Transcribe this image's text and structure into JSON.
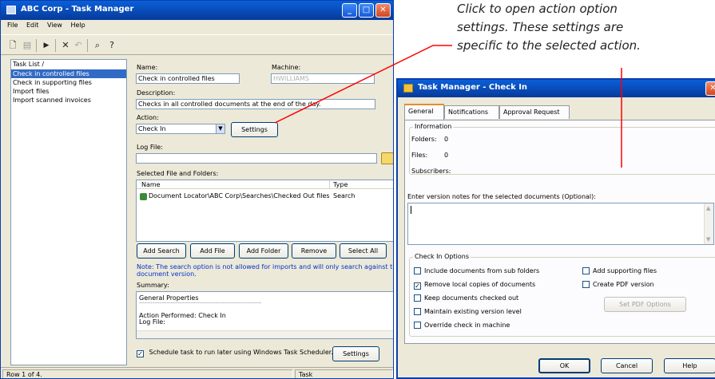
{
  "main_window": {
    "title": "ABC Corp - Task Manager",
    "menu": [
      "File",
      "Edit",
      "View",
      "Help"
    ],
    "task_list": {
      "header": "Task List /",
      "items": [
        "Check in controlled files",
        "Check in supporting files",
        "Import files",
        "Import scanned invoices"
      ],
      "selected_index": 0
    },
    "name_label": "Name:",
    "name_value": "Check in controlled files",
    "machine_label": "Machine:",
    "machine_value": "HWILLIAMS",
    "description_label": "Description:",
    "description_value": "Checks in all controlled documents at the end of the day.",
    "action_label": "Action:",
    "action_value": "Check In",
    "action_settings_button": "Settings",
    "logfile_label": "Log File:",
    "logfile_value": "",
    "selected_label": "Selected File and Folders:",
    "columns": [
      "Name",
      "Type"
    ],
    "rows": [
      {
        "name": "Document Locator\\ABC Corp\\Searches\\Checked Out files",
        "type": "Search"
      }
    ],
    "buttons": {
      "add_search": "Add Search",
      "add_file": "Add File",
      "add_folder": "Add Folder",
      "remove": "Remove",
      "select_all": "Select All"
    },
    "note": "Note: The search option is not allowed for imports and will only search against the la",
    "note_2": "document version.",
    "summary_label": "Summary:",
    "summary_lines": [
      "General Properties",
      "-------------------------------------------------------------------------------------",
      "Action Performed: Check In",
      "Log File:"
    ],
    "schedule_label": "Schedule task to run later using Windows Task Scheduler.",
    "schedule_checked": true,
    "schedule_settings_button": "Settings",
    "status": {
      "left": "Row 1 of 4.",
      "right": "Task"
    }
  },
  "dialog": {
    "title": "Task Manager - Check In",
    "tabs": [
      "General",
      "Notifications",
      "Approval Request"
    ],
    "active_tab": 0,
    "information": {
      "title": "Information",
      "folders_label": "Folders:",
      "folders_value": "0",
      "files_label": "Files:",
      "files_value": "0",
      "subscribers_label": "Subscribers:"
    },
    "version_notes_label": "Enter version notes for the selected documents (Optional):",
    "version_notes_value": "",
    "check_in_options": {
      "title": "Check In Options",
      "include_sub": {
        "label": "Include documents from sub folders",
        "checked": false
      },
      "remove_local": {
        "label": "Remove local copies of documents",
        "checked": true
      },
      "keep_checked_out": {
        "label": "Keep documents checked out",
        "checked": false
      },
      "maintain_version": {
        "label": "Maintain existing version level",
        "checked": false
      },
      "override_machine": {
        "label": "Override check in machine",
        "checked": false
      },
      "add_supporting": {
        "label": "Add supporting files",
        "checked": false
      },
      "create_pdf": {
        "label": "Create PDF version",
        "checked": false
      },
      "set_pdf_button": "Set PDF Options"
    },
    "buttons": {
      "ok": "OK",
      "cancel": "Cancel",
      "help": "Help"
    }
  },
  "annotation": {
    "line1": "Click to open action option",
    "line2": "settings.  These settings are",
    "line3": "specific to the selected action.",
    "color": "#ff0000"
  }
}
